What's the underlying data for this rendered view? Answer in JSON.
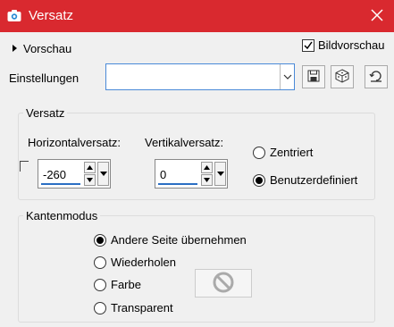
{
  "window": {
    "title": "Versatz",
    "close_icon": "close-icon"
  },
  "preview": {
    "toggle_label": "Vorschau",
    "checkbox_label": "Bildvorschau",
    "checkbox_checked": true
  },
  "settings": {
    "label": "Einstellungen",
    "selected_value": "",
    "buttons": [
      "save-preset-icon",
      "randomize-dice-icon",
      "reset-icon"
    ]
  },
  "offset_group": {
    "legend": "Versatz",
    "horizontal_label": "Horizontalversatz:",
    "horizontal_value": "-260",
    "vertical_label": "Vertikalversatz:",
    "vertical_value": "0",
    "mode_options": [
      {
        "label": "Zentriert",
        "selected": false
      },
      {
        "label": "Benutzerdefiniert",
        "selected": true
      }
    ]
  },
  "edge_group": {
    "legend": "Kantenmodus",
    "options": [
      {
        "label": "Andere Seite übernehmen",
        "selected": true
      },
      {
        "label": "Wiederholen",
        "selected": false
      },
      {
        "label": "Farbe",
        "selected": false
      },
      {
        "label": "Transparent",
        "selected": false
      }
    ],
    "color_swatch_icon": "disabled-icon"
  },
  "colors": {
    "titlebar": "#d9292f",
    "accent": "#2b6fc4"
  }
}
